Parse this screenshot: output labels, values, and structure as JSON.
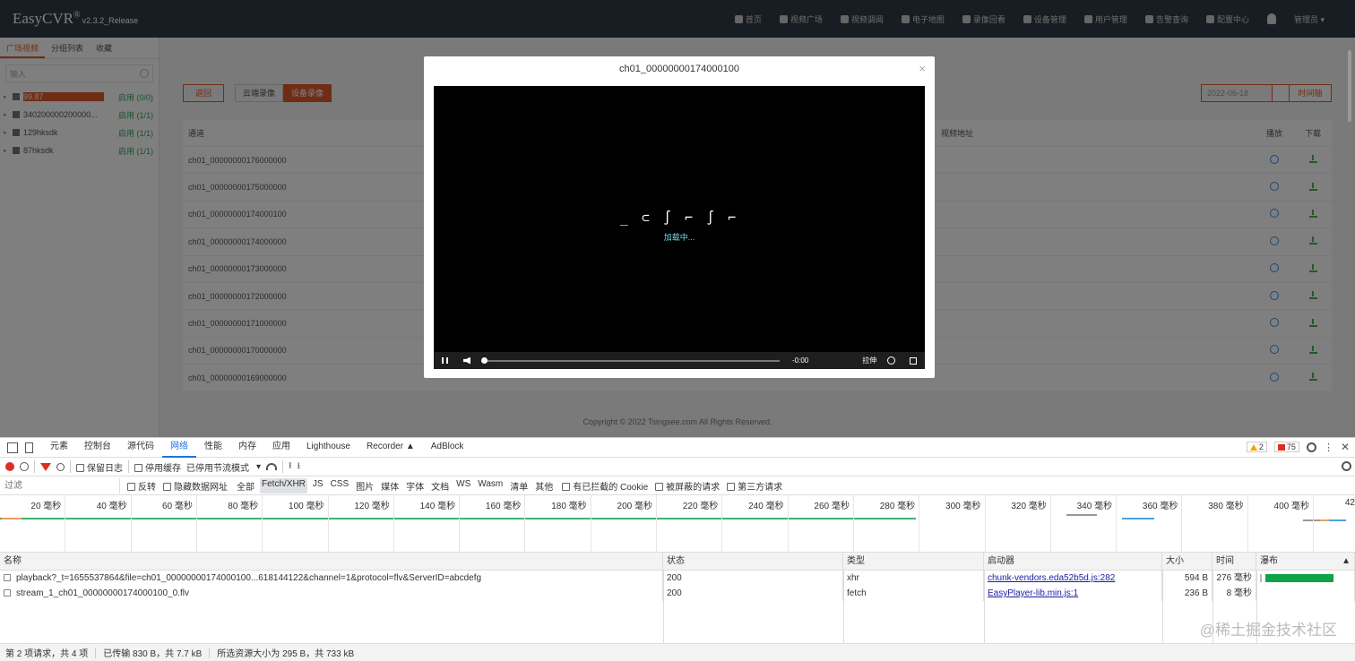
{
  "app": {
    "logo": "EasyCVR",
    "logo_sup": "®",
    "version": "v2.3.2_Release",
    "nav": [
      {
        "label": "首页",
        "icon": "home-icon"
      },
      {
        "label": "视频广场",
        "icon": "play-circle-icon"
      },
      {
        "label": "视频调阅",
        "icon": "grid-icon"
      },
      {
        "label": "电子地图",
        "icon": "map-pin-icon"
      },
      {
        "label": "录像回看",
        "icon": "camera-icon"
      },
      {
        "label": "设备管理",
        "icon": "device-icon"
      },
      {
        "label": "用户管理",
        "icon": "user-icon"
      },
      {
        "label": "告警查询",
        "icon": "alarm-icon"
      },
      {
        "label": "配置中心",
        "icon": "gear-icon"
      }
    ],
    "admin": "管理员 ▾",
    "sidebar": {
      "tabs": [
        "广场视频",
        "分组列表",
        "收藏"
      ],
      "search_placeholder": "输入",
      "tree": [
        {
          "name": "99.87",
          "status": "启用 (0/0)",
          "highlight": true
        },
        {
          "name": "340200000200000...",
          "status": "启用 (1/1)",
          "highlight": false
        },
        {
          "name": "129hksdk",
          "status": "启用 (1/1)",
          "highlight": false
        },
        {
          "name": "87hksdk",
          "status": "启用 (1/1)",
          "highlight": false
        }
      ]
    },
    "buttons": {
      "back": "返回",
      "cloud": "云端录像",
      "device": "设备录像",
      "date": "2022-06-18",
      "time_axis": "时间轴"
    },
    "table": {
      "headers": {
        "channel": "通道",
        "address": "视频地址",
        "play": "播放",
        "download": "下载"
      },
      "rows": [
        "ch01_00000000176000000",
        "ch01_00000000175000000",
        "ch01_00000000174000100",
        "ch01_00000000174000000",
        "ch01_00000000173000000",
        "ch01_00000000172000000",
        "ch01_00000000171000000",
        "ch01_00000000170000000",
        "ch01_00000000169000000"
      ]
    },
    "copyright": "Copyright © 2022 Tsingsee.com All Rights Reserved."
  },
  "modal": {
    "title": "ch01_00000000174000100",
    "close": "×",
    "loading": "加载中...",
    "time": "-0:00",
    "stretch": "拉伸"
  },
  "devtools": {
    "tabs": [
      "元素",
      "控制台",
      "源代码",
      "网络",
      "性能",
      "内存",
      "应用",
      "Lighthouse",
      "Recorder ▲",
      "AdBlock"
    ],
    "warnings": "2",
    "errors": "75",
    "toolbar": {
      "preserve_log": "保留日志",
      "disable_cache": "停用缓存",
      "throttle": "已停用节流模式"
    },
    "filter": {
      "placeholder": "过滤",
      "invert": "反转",
      "hide_data": "隐藏数据网址",
      "types": [
        "全部",
        "Fetch/XHR",
        "JS",
        "CSS",
        "图片",
        "媒体",
        "字体",
        "文档",
        "WS",
        "Wasm",
        "清单",
        "其他"
      ],
      "blocked_cookies": "有已拦截的 Cookie",
      "blocked_requests": "被屏蔽的请求",
      "third_party": "第三方请求"
    },
    "timeline": [
      "20 毫秒",
      "40 毫秒",
      "60 毫秒",
      "80 毫秒",
      "100 毫秒",
      "120 毫秒",
      "140 毫秒",
      "160 毫秒",
      "180 毫秒",
      "200 毫秒",
      "220 毫秒",
      "240 毫秒",
      "260 毫秒",
      "280 毫秒",
      "300 毫秒",
      "320 毫秒",
      "340 毫秒",
      "360 毫秒",
      "380 毫秒",
      "400 毫秒",
      "42"
    ],
    "columns": {
      "name": "名称",
      "status": "状态",
      "type": "类型",
      "initiator": "启动器",
      "size": "大小",
      "time": "时间",
      "waterfall": "瀑布"
    },
    "requests": [
      {
        "name": "playback?_t=1655537864&file=ch01_00000000174000100...618144122&channel=1&protocol=flv&ServerID=abcdefg",
        "status": "200",
        "type": "xhr",
        "initiator": "chunk-vendors.eda52b5d.js:282",
        "size": "594 B",
        "time": "276 毫秒"
      },
      {
        "name": "stream_1_ch01_00000000174000100_0.flv",
        "status": "200",
        "type": "fetch",
        "initiator": "EasyPlayer-lib.min.js:1",
        "size": "236 B",
        "time": "8 毫秒"
      }
    ],
    "status": {
      "requests": "第 2 项请求，共 4 项",
      "transferred": "已传输 830 B，共 7.7 kB",
      "resources": "所选资源大小为 295 B，共 733 kB"
    },
    "watermark": "@稀土掘金技术社区"
  }
}
